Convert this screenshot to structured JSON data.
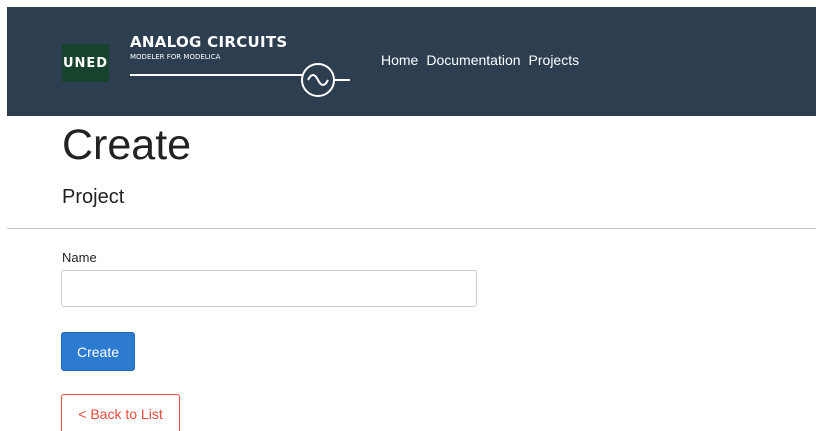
{
  "brand": {
    "logo_text": "UNED",
    "title": "ANALOG CIRCUITS",
    "subtitle": "MODELER FOR MODELICA"
  },
  "nav": {
    "items": [
      {
        "label": "Home"
      },
      {
        "label": "Documentation"
      },
      {
        "label": "Projects"
      }
    ]
  },
  "page": {
    "title": "Create",
    "subtitle": "Project"
  },
  "form": {
    "name_label": "Name",
    "name_value": "",
    "name_placeholder": "",
    "submit_label": "Create"
  },
  "back_link": {
    "label": "< Back to List"
  },
  "colors": {
    "navbar": "#2c3e50",
    "logo_green": "#17432c",
    "primary": "#2c7bd0",
    "danger": "#e74c3c"
  }
}
